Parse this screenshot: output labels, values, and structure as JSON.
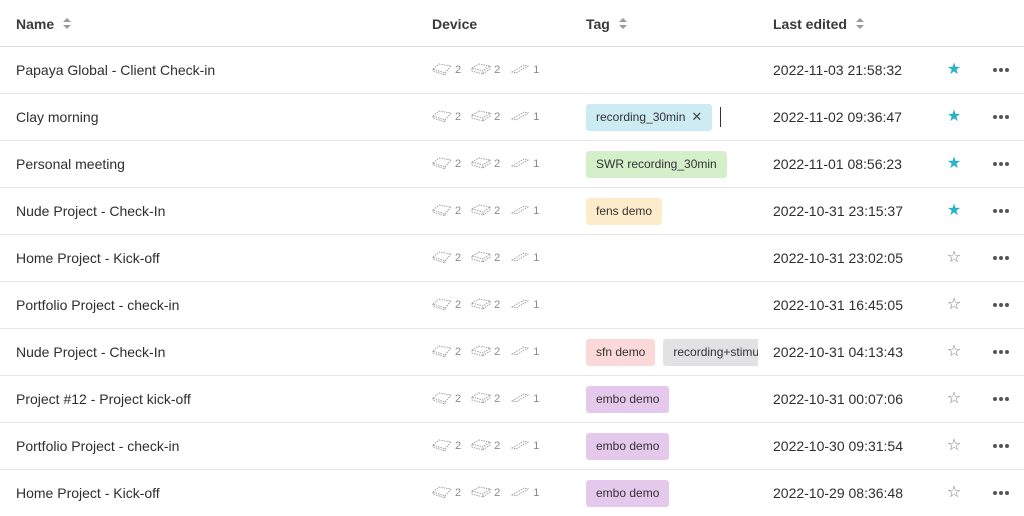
{
  "header": {
    "name": "Name",
    "device": "Device",
    "tag": "Tag",
    "last_edited": "Last edited"
  },
  "rows": [
    {
      "name": "Papaya Global - Client Check-in",
      "devices": [
        "2",
        "2",
        "1"
      ],
      "tags": [],
      "date": "2022-11-03 21:58:32",
      "starred": true
    },
    {
      "name": "Clay morning",
      "devices": [
        "2",
        "2",
        "1"
      ],
      "tags": [
        {
          "label": "recording_30min",
          "color": "#cdebf3",
          "removable": true
        }
      ],
      "date": "2022-11-02 09:36:47",
      "starred": true
    },
    {
      "name": "Personal meeting",
      "devices": [
        "2",
        "2",
        "1"
      ],
      "tags": [
        {
          "label": "SWR recording_30min",
          "color": "#d4efc9"
        }
      ],
      "date": "2022-11-01 08:56:23",
      "starred": true
    },
    {
      "name": "Nude Project - Check-In",
      "devices": [
        "2",
        "2",
        "1"
      ],
      "tags": [
        {
          "label": "fens demo",
          "color": "#fdeccb"
        }
      ],
      "date": "2022-10-31 23:15:37",
      "starred": true
    },
    {
      "name": "Home Project - Kick-off",
      "devices": [
        "2",
        "2",
        "1"
      ],
      "tags": [],
      "date": "2022-10-31 23:02:05",
      "starred": false
    },
    {
      "name": "Portfolio Project - check-in",
      "devices": [
        "2",
        "2",
        "1"
      ],
      "tags": [],
      "date": "2022-10-31 16:45:05",
      "starred": false
    },
    {
      "name": "Nude Project - Check-In",
      "devices": [
        "2",
        "2",
        "1"
      ],
      "tags": [
        {
          "label": "sfn demo",
          "color": "#fbd9d9"
        },
        {
          "label": "recording+stimu",
          "color": "#e2e2e4"
        }
      ],
      "date": "2022-10-31 04:13:43",
      "starred": false
    },
    {
      "name": "Project #12 - Project kick-off",
      "devices": [
        "2",
        "2",
        "1"
      ],
      "tags": [
        {
          "label": "embo demo",
          "color": "#e5c9ec"
        }
      ],
      "date": "2022-10-31 00:07:06",
      "starred": false
    },
    {
      "name": "Portfolio Project - check-in",
      "devices": [
        "2",
        "2",
        "1"
      ],
      "tags": [
        {
          "label": "embo demo",
          "color": "#e5c9ec"
        }
      ],
      "date": "2022-10-30 09:31:54",
      "starred": false
    },
    {
      "name": "Home Project - Kick-off",
      "devices": [
        "2",
        "2",
        "1"
      ],
      "tags": [
        {
          "label": "embo demo",
          "color": "#e5c9ec"
        }
      ],
      "date": "2022-10-29 08:36:48",
      "starred": false
    }
  ],
  "icons": {
    "sort": "sort-icon",
    "device_types": [
      "device-type-a-icon",
      "device-type-b-icon",
      "device-type-c-icon"
    ],
    "remove_tag": "close-icon",
    "star": "star-icon",
    "more": "more-horizontal-icon"
  },
  "colors": {
    "star_active": "#2ab3c7",
    "star_inactive": "#7a7a7a"
  }
}
